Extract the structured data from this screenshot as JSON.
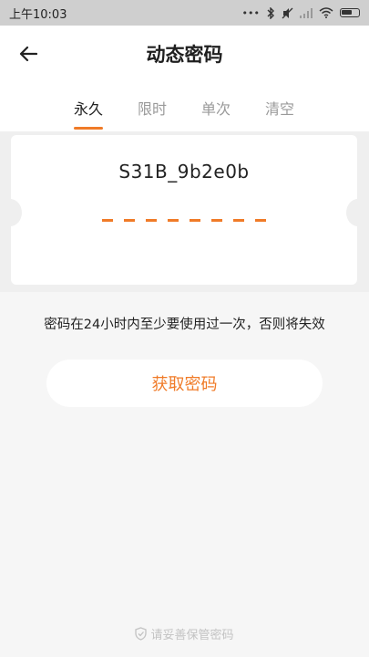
{
  "status_bar": {
    "time": "上午10:03",
    "icons": [
      "dots-icon",
      "bluetooth-icon",
      "mute-icon",
      "signal-icon",
      "wifi-icon",
      "battery-icon"
    ]
  },
  "header": {
    "back_icon": "arrow-left-icon",
    "title": "动态密码"
  },
  "tabs": [
    {
      "label": "永久",
      "active": true
    },
    {
      "label": "限时",
      "active": false
    },
    {
      "label": "单次",
      "active": false
    },
    {
      "label": "清空",
      "active": false
    }
  ],
  "card": {
    "device_id": "S31B_9b2e0b",
    "password_placeholder_dashes": 8
  },
  "notice": "密码在24小时内至少要使用过一次，否则将失效",
  "get_button_label": "获取密码",
  "footer": {
    "icon": "shield-icon",
    "text": "请妥善保管密码"
  },
  "colors": {
    "accent": "#f07b28",
    "background": "#f6f6f6",
    "status_bar": "#cfcfcf"
  }
}
